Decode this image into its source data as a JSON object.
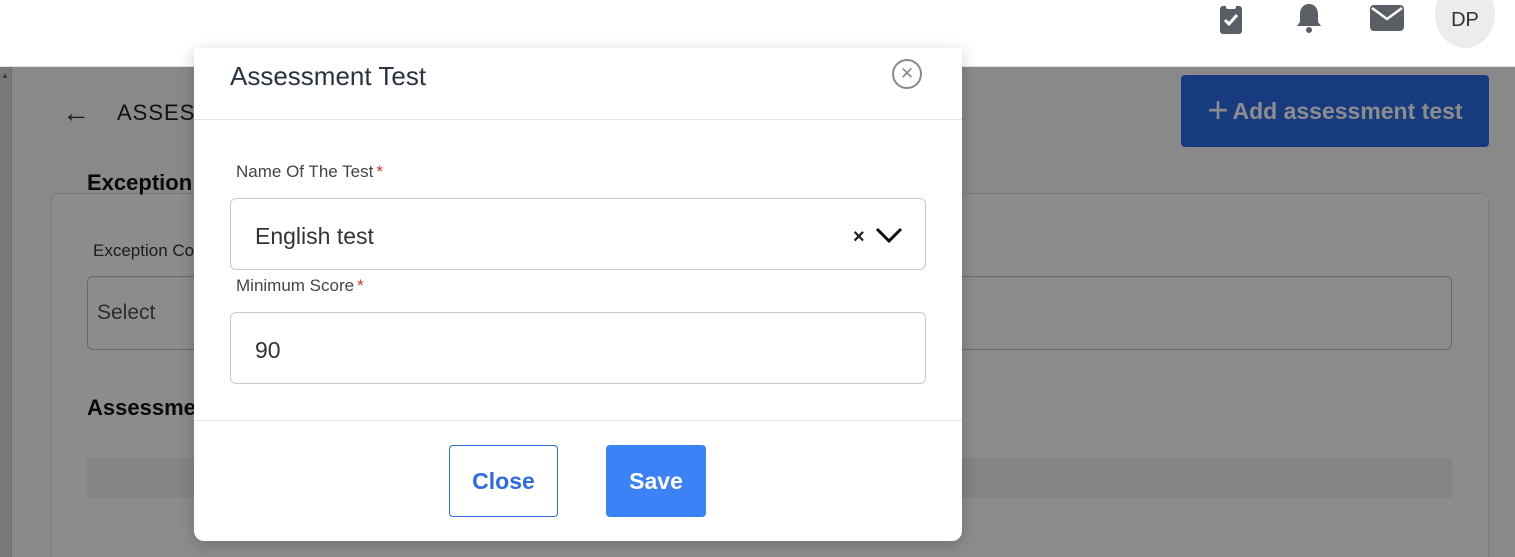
{
  "topbar": {
    "icons": [
      "clipboard-check-icon",
      "bell-icon",
      "mail-icon"
    ],
    "avatar_initials": "DP"
  },
  "page": {
    "title": "ASSESS",
    "add_button_label": "Add assessment test",
    "exception_section_title": "Exception",
    "exception_field_label": "Exception Co",
    "exception_select_placeholder": "Select",
    "assessment_section_title": "Assessme"
  },
  "modal": {
    "title": "Assessment Test",
    "test_name_label": "Name Of The Test",
    "test_name_value": "English test",
    "min_score_label": "Minimum Score",
    "min_score_value": "90",
    "required_marker": "*",
    "close_label": "Close",
    "save_label": "Save"
  },
  "colors": {
    "primary": "#2d6be6",
    "save": "#3b82f6",
    "required": "#d33333"
  }
}
